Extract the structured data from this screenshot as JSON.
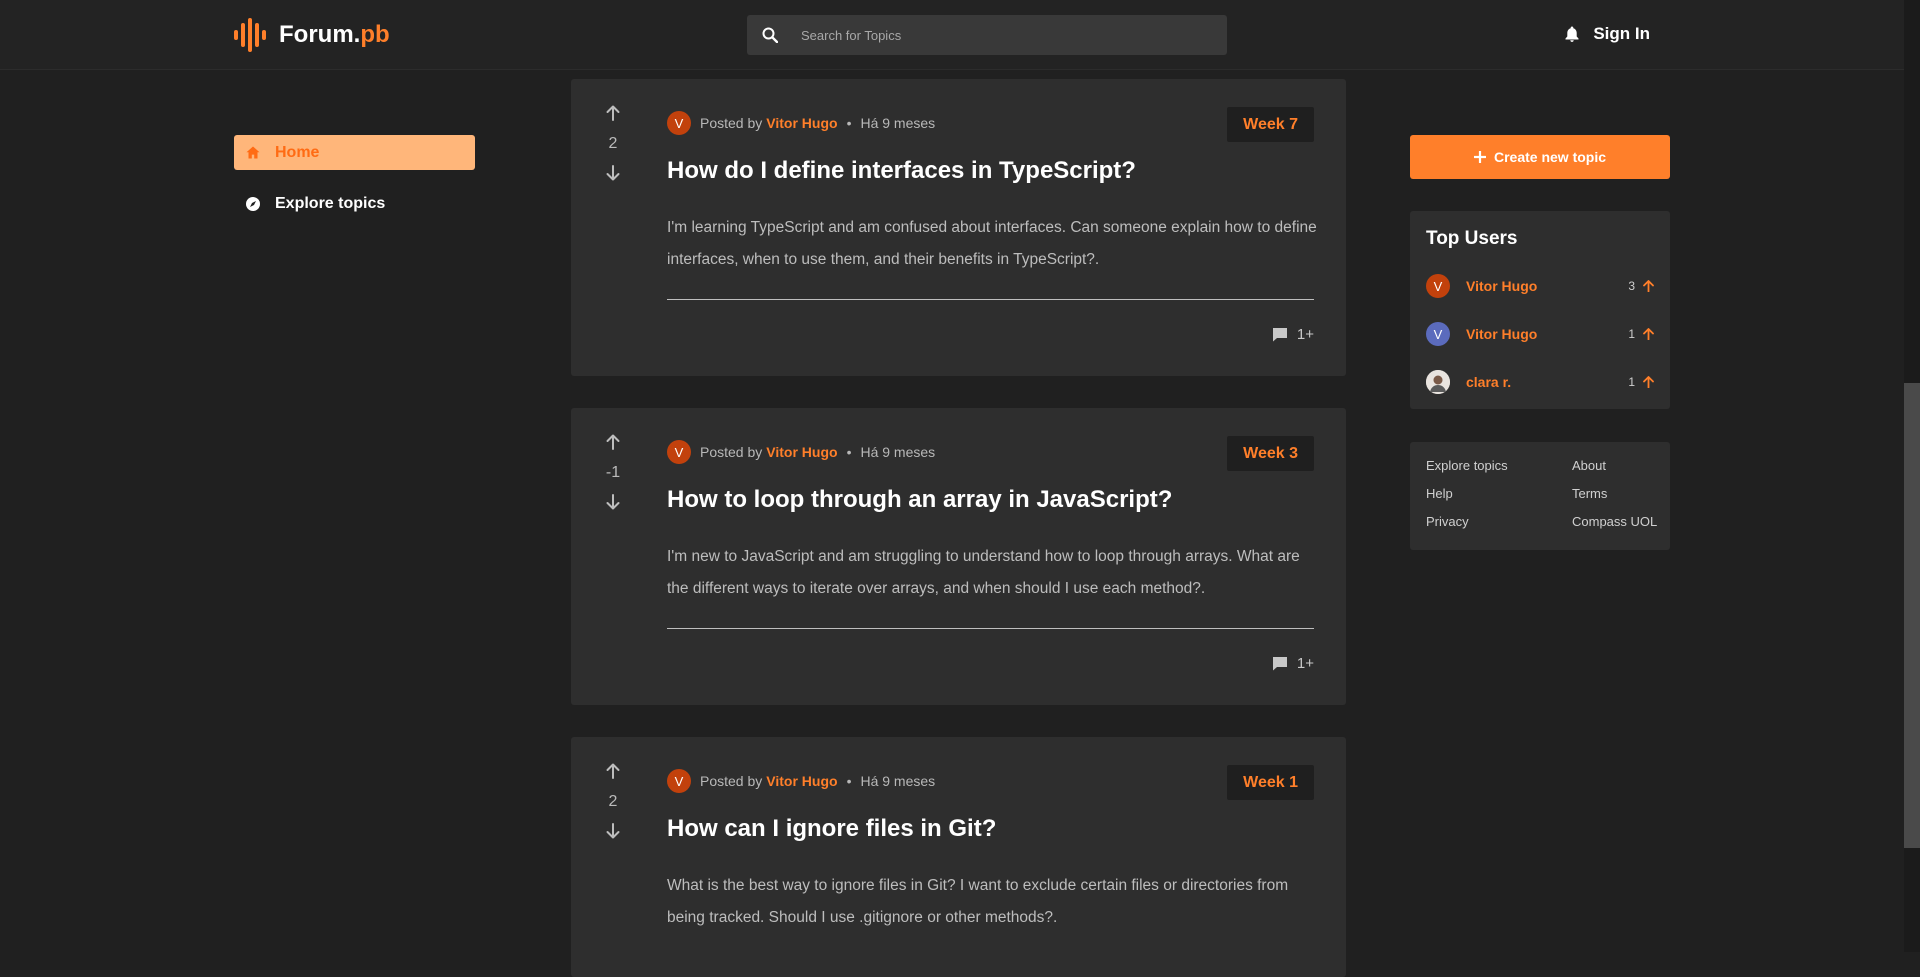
{
  "header": {
    "logo_main": "Forum.",
    "logo_accent": "pb",
    "search_placeholder": "Search for Topics",
    "signin_label": "Sign In"
  },
  "sidebar": {
    "items": [
      {
        "label": "Home",
        "icon": "home-icon",
        "active": true
      },
      {
        "label": "Explore topics",
        "icon": "compass-icon",
        "active": false
      }
    ]
  },
  "posts": [
    {
      "votes": "2",
      "posted_by": "Posted by",
      "author": "Vitor Hugo",
      "avatar_letter": "V",
      "time": "Há 9 meses",
      "week": "Week 7",
      "title": "How do I define interfaces in TypeScript?",
      "body": "I'm learning TypeScript and am confused about interfaces. Can someone explain how to define interfaces, when to use them, and their benefits in TypeScript?.",
      "comments": "1+"
    },
    {
      "votes": "-1",
      "posted_by": "Posted by",
      "author": "Vitor Hugo",
      "avatar_letter": "V",
      "time": "Há 9 meses",
      "week": "Week 3",
      "title": "How to loop through an array in JavaScript?",
      "body": "I'm new to JavaScript and am struggling to understand how to loop through arrays. What are the different ways to iterate over arrays, and when should I use each method?.",
      "comments": "1+"
    },
    {
      "votes": "2",
      "posted_by": "Posted by",
      "author": "Vitor Hugo",
      "avatar_letter": "V",
      "time": "Há 9 meses",
      "week": "Week 1",
      "title": "How can I ignore files in Git?",
      "body": "What is the best way to ignore files in Git? I want to exclude certain files or directories from being tracked. Should I use .gitignore or other methods?.",
      "comments": ""
    }
  ],
  "right": {
    "create_label": "Create new topic",
    "top_users_title": "Top Users",
    "top_users": [
      {
        "name": "Vitor Hugo",
        "points": "3",
        "avatar_letter": "V",
        "avatar_color": "#c2410c"
      },
      {
        "name": "Vitor Hugo",
        "points": "1",
        "avatar_letter": "V",
        "avatar_color": "#5b6bbd"
      },
      {
        "name": "clara r.",
        "points": "1",
        "avatar_letter": "",
        "avatar_color": "#d8d0c8"
      }
    ],
    "footer_links": [
      "Explore topics",
      "About",
      "Help",
      "Terms",
      "Privacy",
      "Compass UOL"
    ]
  },
  "colors": {
    "accent": "#ff7f2a",
    "background": "#202020",
    "card": "#2e2e2e"
  }
}
